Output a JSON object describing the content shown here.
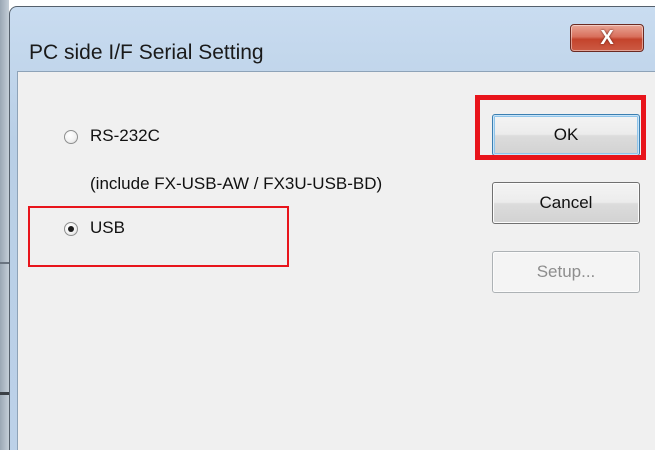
{
  "window": {
    "title": "PC side I/F Serial Setting",
    "close_label": "X"
  },
  "options": {
    "rs232c": {
      "label": "RS-232C",
      "selected": false,
      "note": "(include FX-USB-AW / FX3U-USB-BD)"
    },
    "usb": {
      "label": "USB",
      "selected": true
    }
  },
  "buttons": {
    "ok_label": "OK",
    "cancel_label": "Cancel",
    "setup_label": "Setup..."
  },
  "colors": {
    "annotation_red": "#e8141b",
    "dialog_face": "#f0f0f0",
    "disabled_text": "#8d8d8d"
  }
}
